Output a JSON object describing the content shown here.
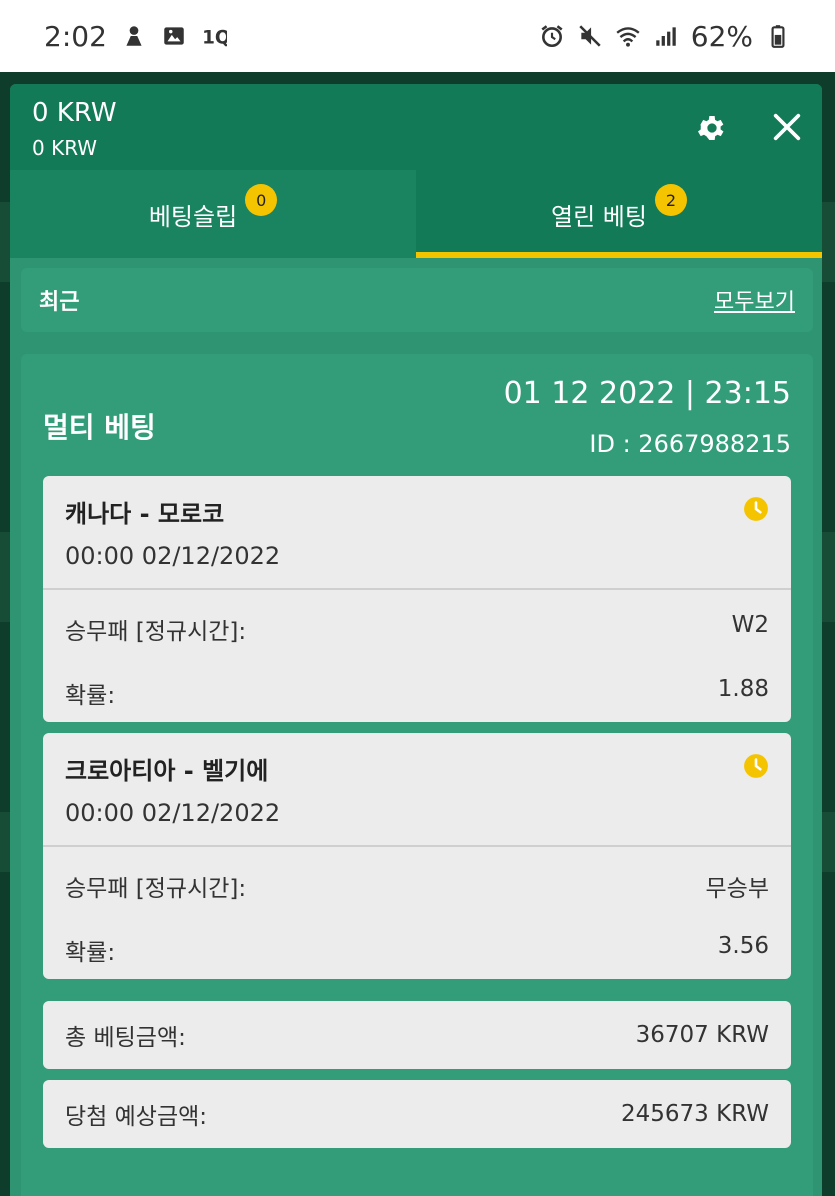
{
  "status_bar": {
    "time": "2:02",
    "battery": "62%"
  },
  "header": {
    "balance_main": "0 KRW",
    "balance_sub": "0 KRW"
  },
  "tabs": [
    {
      "label": "베팅슬립",
      "badge": "0"
    },
    {
      "label": "열린 베팅",
      "badge": "2"
    }
  ],
  "recent": {
    "title": "최근",
    "view_all": "모두보기"
  },
  "bet": {
    "type": "멀티 베팅",
    "datetime": "01 12 2022 | 23:15",
    "id_text": "ID :  2667988215",
    "events": [
      {
        "name": "캐나다 - 모로코",
        "time": "00:00   02/12/2022",
        "market_label": "승무패 [정규시간]:",
        "market_value": "W2",
        "odds_label": "확률:",
        "odds_value": "1.88"
      },
      {
        "name": "크로아티아 - 벨기에",
        "time": "00:00   02/12/2022",
        "market_label": "승무패 [정규시간]:",
        "market_value": "무승부",
        "odds_label": "확률:",
        "odds_value": "3.56"
      }
    ],
    "total_label": "총 베팅금액:",
    "total_value": "36707 KRW",
    "potential_label": "당첨 예상금액:",
    "potential_value": "245673 KRW"
  },
  "colors": {
    "header_green": "#127a56",
    "panel_green": "#2e9472",
    "accent_yellow": "#f5c400"
  }
}
